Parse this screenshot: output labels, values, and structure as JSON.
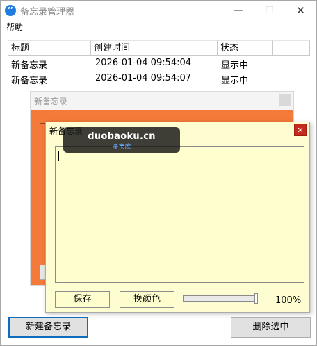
{
  "window": {
    "title": "备忘录管理器",
    "controls": {
      "minimize": "—",
      "maximize": "☐",
      "close": "✕"
    }
  },
  "menu": {
    "help": "帮助"
  },
  "list": {
    "columns": [
      "标题",
      "创建时间",
      "状态"
    ],
    "rows": [
      {
        "title": "新备忘录",
        "created": "2026-01-04 09:54:04",
        "status": "显示中"
      },
      {
        "title": "新备忘录",
        "created": "2026-01-04 09:54:07",
        "status": "显示中"
      }
    ]
  },
  "note_back": {
    "title": "新备忘录",
    "color": "#f47a3a"
  },
  "note_front": {
    "title": "新备忘录",
    "close_icon": "✕",
    "text": "",
    "save_label": "保存",
    "color_label": "换颜色",
    "opacity_percent": 100,
    "opacity_text": "100%",
    "color": "#fefdd1"
  },
  "watermark": {
    "main": "duobaoku.cn",
    "sub": "多宝库"
  },
  "buttons": {
    "new_note": "新建备忘录",
    "delete_selected": "删除选中"
  }
}
